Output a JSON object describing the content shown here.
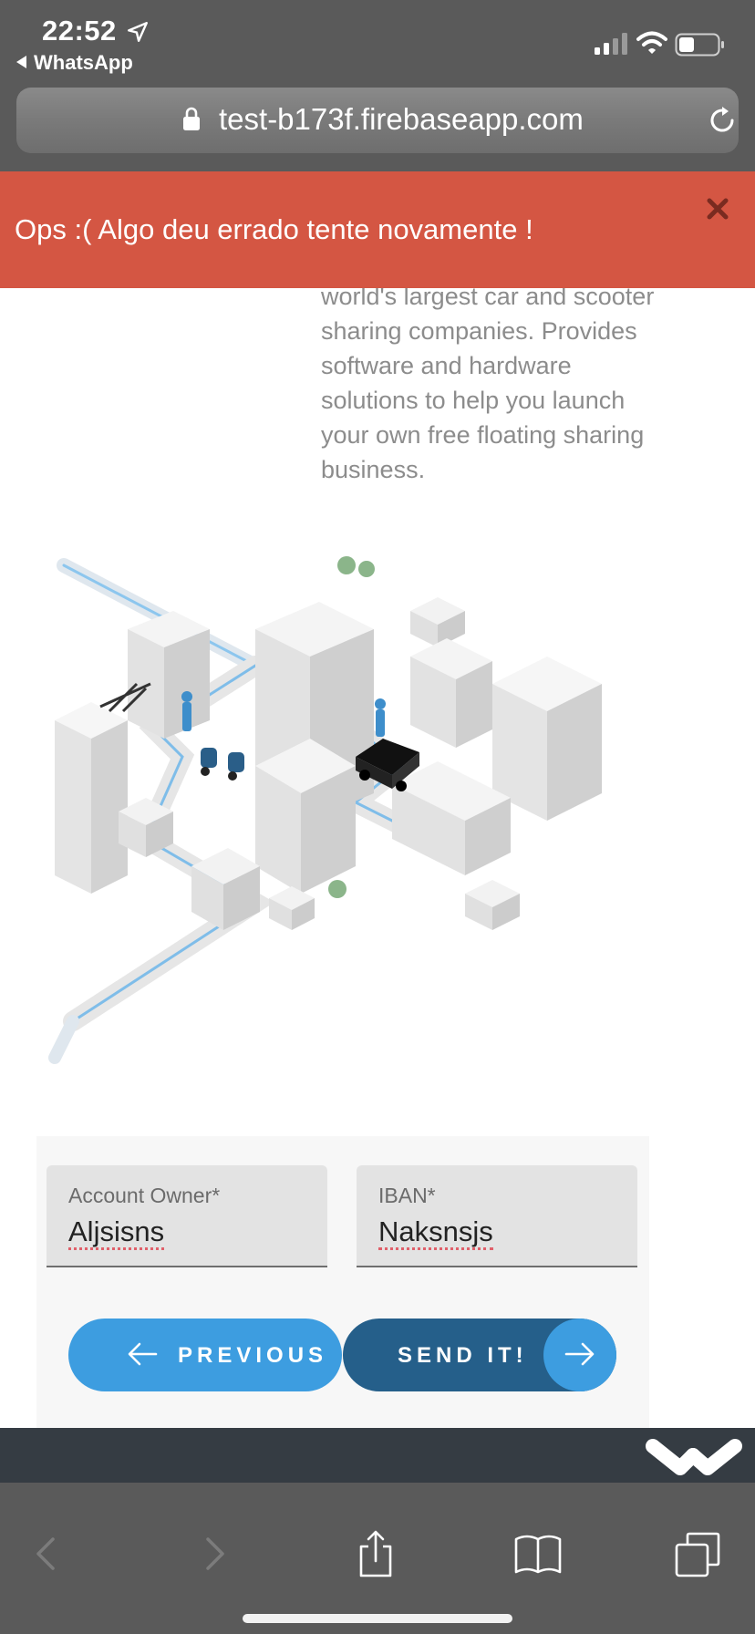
{
  "status_bar": {
    "time": "22:52",
    "back_app": "WhatsApp"
  },
  "browser": {
    "url": "test-b173f.firebaseapp.com"
  },
  "error_banner": {
    "message": "Ops :( Algo deu errado tente novamente !",
    "background": "#d45643"
  },
  "intro": {
    "description_lines": [
      "world's largest car and scooter",
      "sharing companies. Provides",
      "software and hardware",
      "solutions to help you launch",
      "your own free floating sharing",
      "business."
    ]
  },
  "form": {
    "account_owner": {
      "label": "Account Owner*",
      "value": "Aljsisns"
    },
    "iban": {
      "label": "IBAN*",
      "value": "Naksnsjs"
    }
  },
  "buttons": {
    "previous_label": "PREVIOUS",
    "send_label": "SEND IT!"
  },
  "colors": {
    "accent": "#3d9de0",
    "primary_dark": "#255f8a",
    "footer": "#353c43",
    "chrome": "#5a5a5a"
  }
}
